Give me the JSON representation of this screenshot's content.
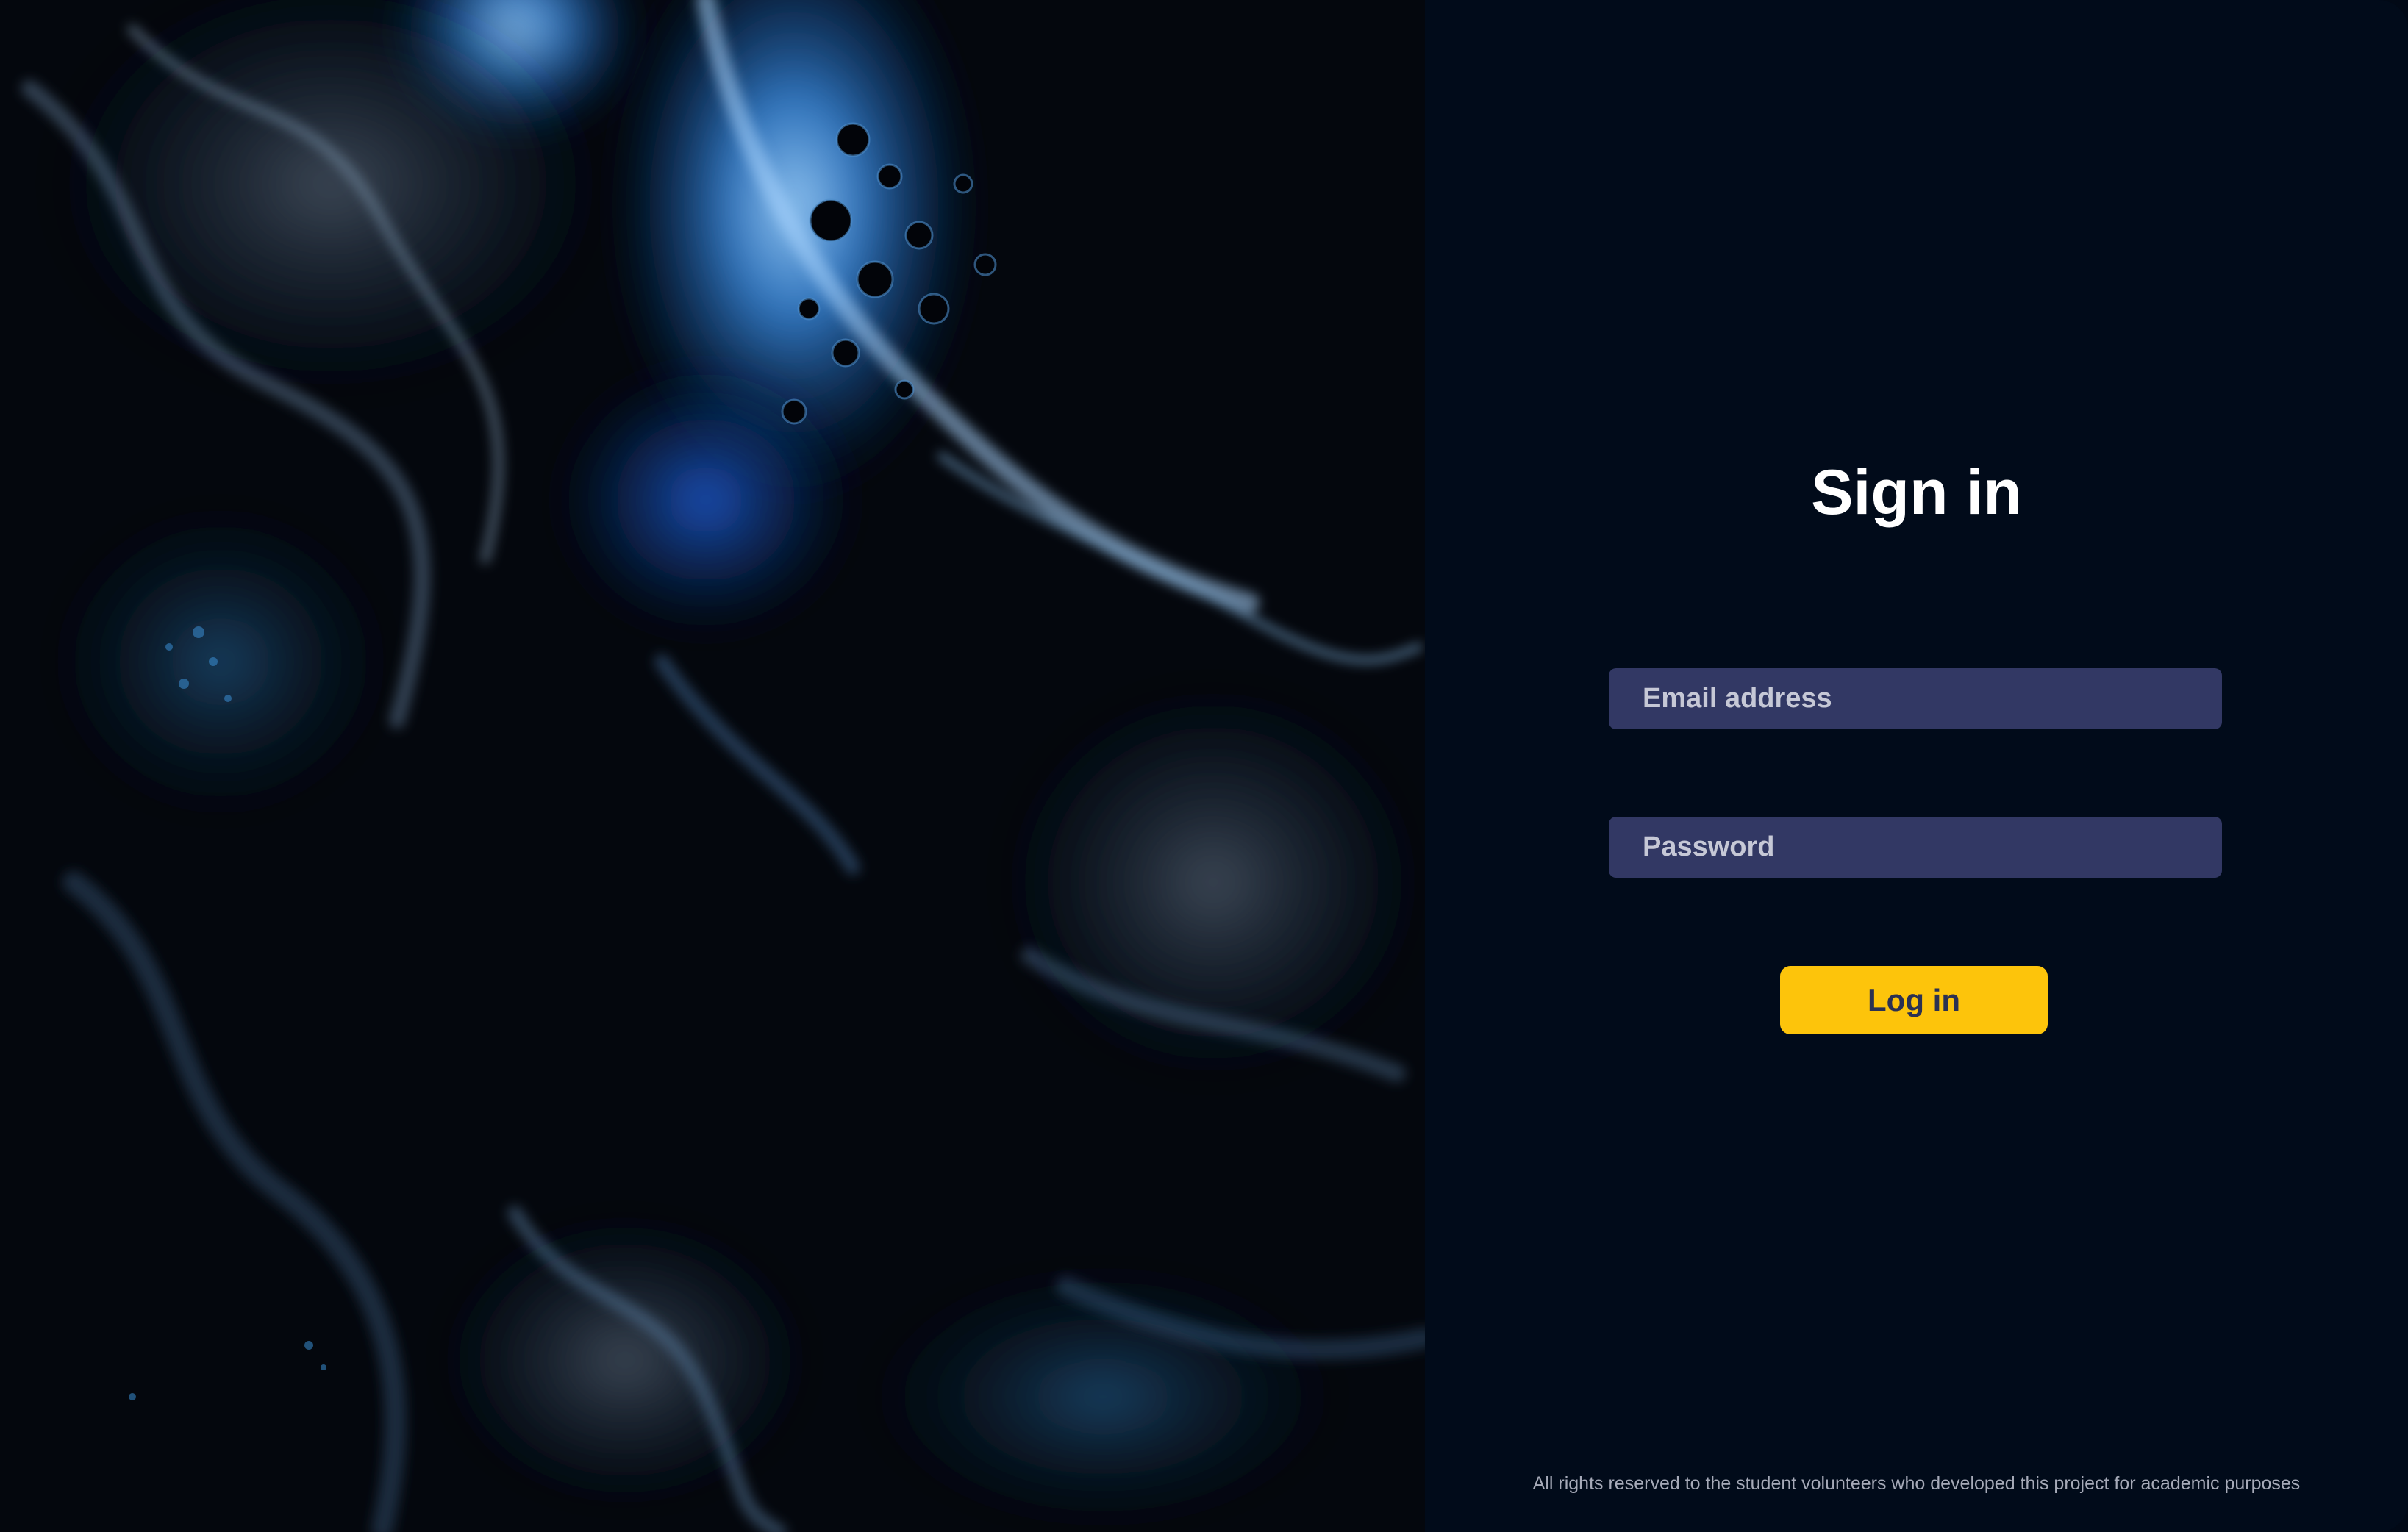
{
  "signin": {
    "title": "Sign in",
    "email_placeholder": "Email address",
    "password_placeholder": "Password",
    "login_label": "Log in"
  },
  "footer": {
    "text": "All rights reserved to the student volunteers who developed this project for academic purposes"
  },
  "colors": {
    "background": "#010b1a",
    "input_background": "#323864",
    "button_background": "#fdc40b",
    "button_text": "#2b3152",
    "title_text": "#ffffff"
  },
  "icons": {
    "art_panel": "abstract-fluid-art-image"
  }
}
